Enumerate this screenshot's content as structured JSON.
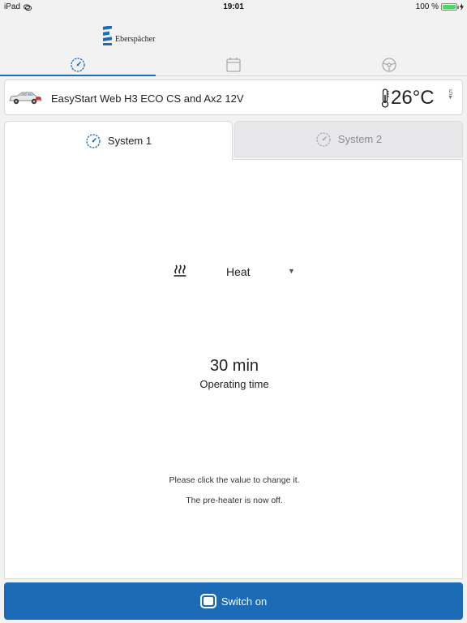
{
  "status_bar": {
    "device": "iPad",
    "time": "19:01",
    "battery": "100 %",
    "battery_level": 1.0
  },
  "header": {
    "brand": "Eberspächer",
    "nav_tabs": [
      {
        "name": "heater-control",
        "active": true
      },
      {
        "name": "calendar",
        "active": false,
        "label": "31"
      },
      {
        "name": "steering-wheel",
        "active": false
      }
    ]
  },
  "device": {
    "name": "EasyStart Web H3 ECO CS and Ax2 12V",
    "temperature": "26°C",
    "level": "5"
  },
  "systems": {
    "tabs": [
      {
        "label": "System 1",
        "active": true
      },
      {
        "label": "System 2",
        "active": false
      }
    ]
  },
  "panel": {
    "mode": "Heat",
    "operating_time_value": "30 min",
    "operating_time_label": "Operating time",
    "hint_change": "Please click the value to change it.",
    "status_text": "The pre-heater is now off."
  },
  "actions": {
    "switch_label": "Switch on"
  },
  "colors": {
    "accent": "#1c6bb7",
    "battery": "#4cd964",
    "inactive_tab_bg": "#e8e8ea"
  },
  "icons": [
    "wifi-icon",
    "battery-icon",
    "eberspaecher-logo-icon",
    "dial-icon",
    "calendar-icon",
    "steering-wheel-icon",
    "car-icon",
    "thermometer-icon",
    "heat-icon",
    "switch-icon"
  ]
}
